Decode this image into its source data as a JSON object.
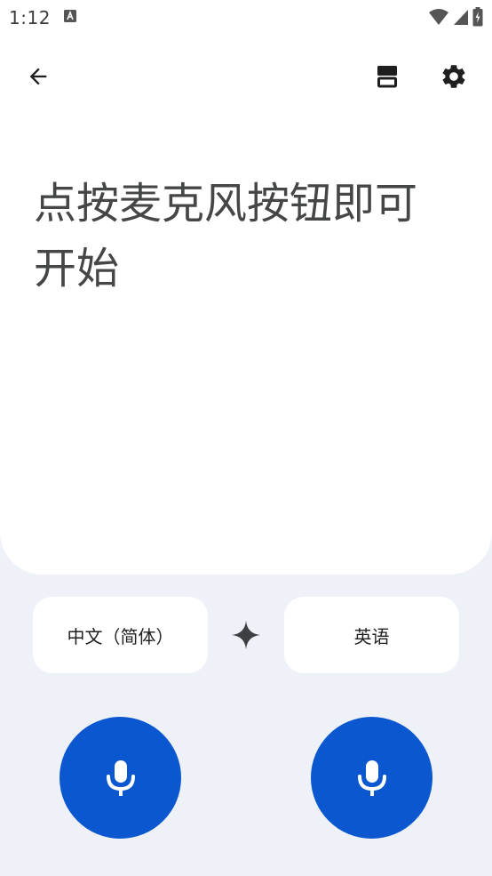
{
  "status_bar": {
    "time": "1:12"
  },
  "app_bar": {
    "back_icon": "arrow-back-icon",
    "split_icon": "split-screen-icon",
    "settings_icon": "gear-icon"
  },
  "main": {
    "prompt": "点按麦克风按钮即可开始"
  },
  "languages": {
    "source": "中文（简体）",
    "target": "英语",
    "swap_icon": "sparkle-icon"
  },
  "mic_buttons": {
    "left_icon": "microphone-icon",
    "right_icon": "microphone-icon"
  },
  "colors": {
    "accent": "#0b57d0",
    "background": "#eef1f7",
    "card": "#ffffff",
    "text": "#444746"
  }
}
